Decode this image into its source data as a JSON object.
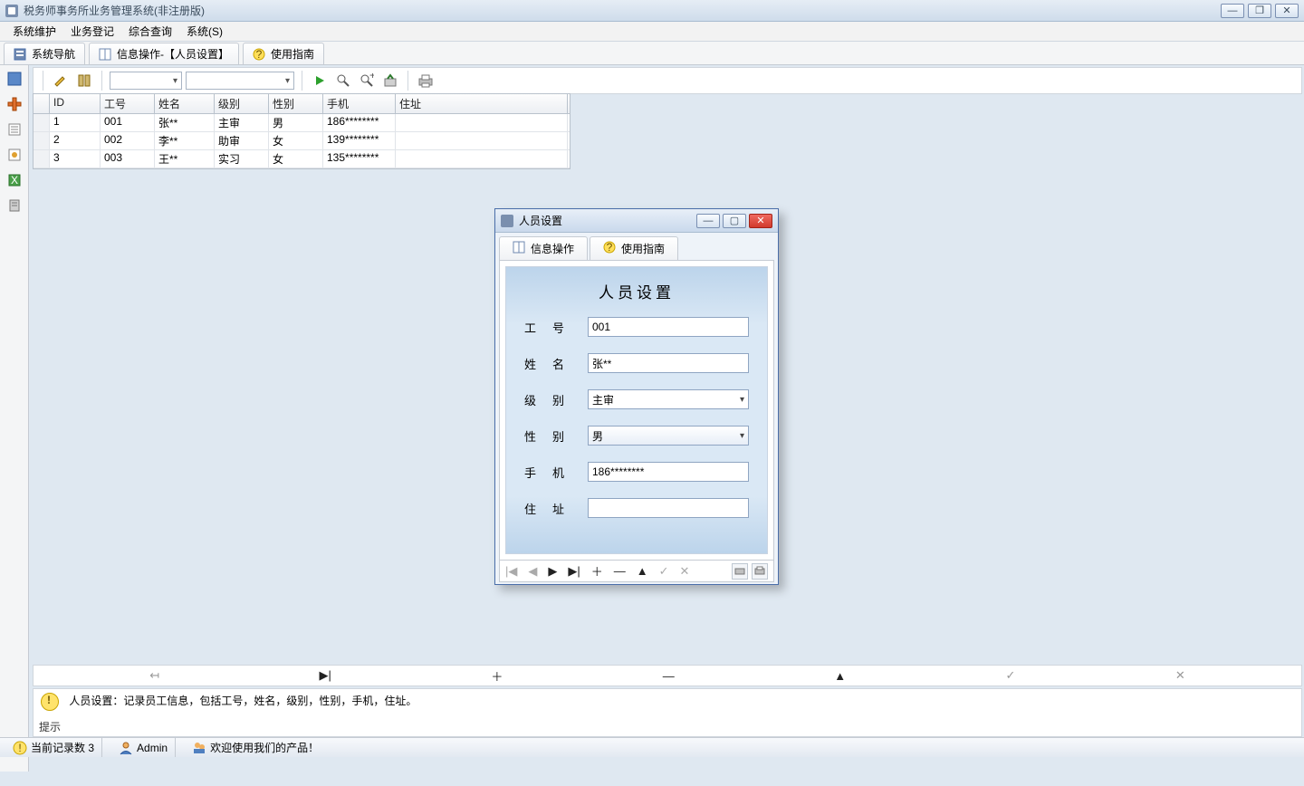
{
  "window": {
    "title": "税务师事务所业务管理系统(非注册版)"
  },
  "menus": [
    "系统维护",
    "业务登记",
    "综合查询",
    "系统(S)"
  ],
  "doctabs": [
    {
      "label": "系统导航",
      "icon": "nav-icon"
    },
    {
      "label": "信息操作-【人员设置】",
      "icon": "book-icon"
    },
    {
      "label": "使用指南",
      "icon": "help-icon"
    }
  ],
  "grid": {
    "headers": {
      "id": "ID",
      "gh": "工号",
      "xm": "姓名",
      "jb": "级别",
      "xb": "性别",
      "sj": "手机",
      "dz": "住址"
    },
    "rows": [
      {
        "id": "1",
        "gh": "001",
        "xm": "张**",
        "jb": "主审",
        "xb": "男",
        "sj": "186********",
        "dz": ""
      },
      {
        "id": "2",
        "gh": "002",
        "xm": "李**",
        "jb": "助审",
        "xb": "女",
        "sj": "139********",
        "dz": ""
      },
      {
        "id": "3",
        "gh": "003",
        "xm": "王**",
        "jb": "实习",
        "xb": "女",
        "sj": "135********",
        "dz": ""
      }
    ]
  },
  "dialog": {
    "title": "人员设置",
    "tabs": [
      "信息操作",
      "使用指南"
    ],
    "heading": "人员设置",
    "labels": {
      "gh": "工号",
      "xm": "姓名",
      "jb": "级别",
      "xb": "性别",
      "sj": "手机",
      "dz": "住址"
    },
    "values": {
      "gh": "001",
      "xm": "张**",
      "jb": "主审",
      "xb": "男",
      "sj": "186********",
      "dz": ""
    }
  },
  "tip": {
    "text": "人员设置：记录员工信息，包括工号，姓名，级别，性别，手机，住址。",
    "label": "提示"
  },
  "status": {
    "records_label": "当前记录数",
    "records_count": "3",
    "user": "Admin",
    "welcome": "欢迎使用我们的产品！"
  }
}
